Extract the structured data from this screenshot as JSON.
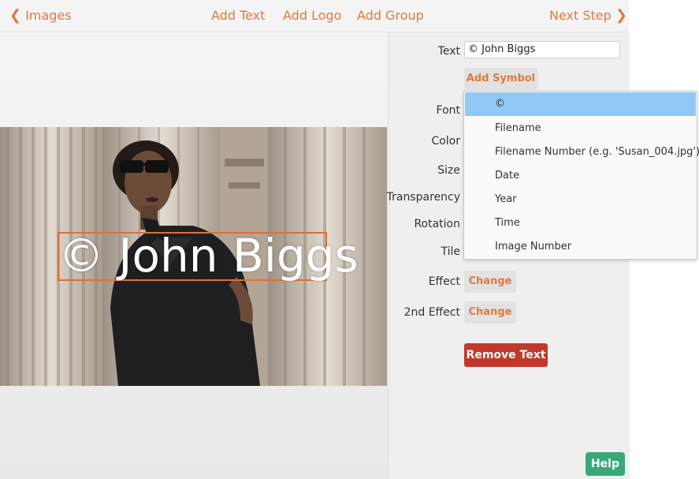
{
  "topbar": {
    "back_label": "Images",
    "add_text": "Add Text",
    "add_logo": "Add Logo",
    "add_group": "Add Group",
    "next_label": "Next Step"
  },
  "canvas": {
    "watermark_text": "© John Biggs"
  },
  "panel": {
    "text_label": "Text",
    "text_value": "© John Biggs",
    "add_symbol": "Add Symbol",
    "font_label": "Font",
    "color_label": "Color",
    "size_label": "Size",
    "transparency_label": "Transparency",
    "rotation_label": "Rotation",
    "tile_label": "Tile",
    "effect_label": "Effect",
    "effect_button": "Change",
    "effect2_label": "2nd Effect",
    "effect2_button": "Change",
    "remove_text": "Remove Text"
  },
  "symbol_menu": {
    "items": [
      {
        "label": "©"
      },
      {
        "label": "Filename"
      },
      {
        "label": "Filename Number (e.g. 'Susan_004.jpg')"
      },
      {
        "label": "Date"
      },
      {
        "label": "Year"
      },
      {
        "label": "Time"
      },
      {
        "label": "Image Number"
      }
    ]
  },
  "help_label": "Help",
  "colors": {
    "accent": "#e0793f",
    "remove": "#c1392b",
    "help": "#3aa97a",
    "selected_item": "#92c8f5"
  },
  "icons": {
    "back": "chevron-left-icon",
    "next": "chevron-right-icon"
  }
}
